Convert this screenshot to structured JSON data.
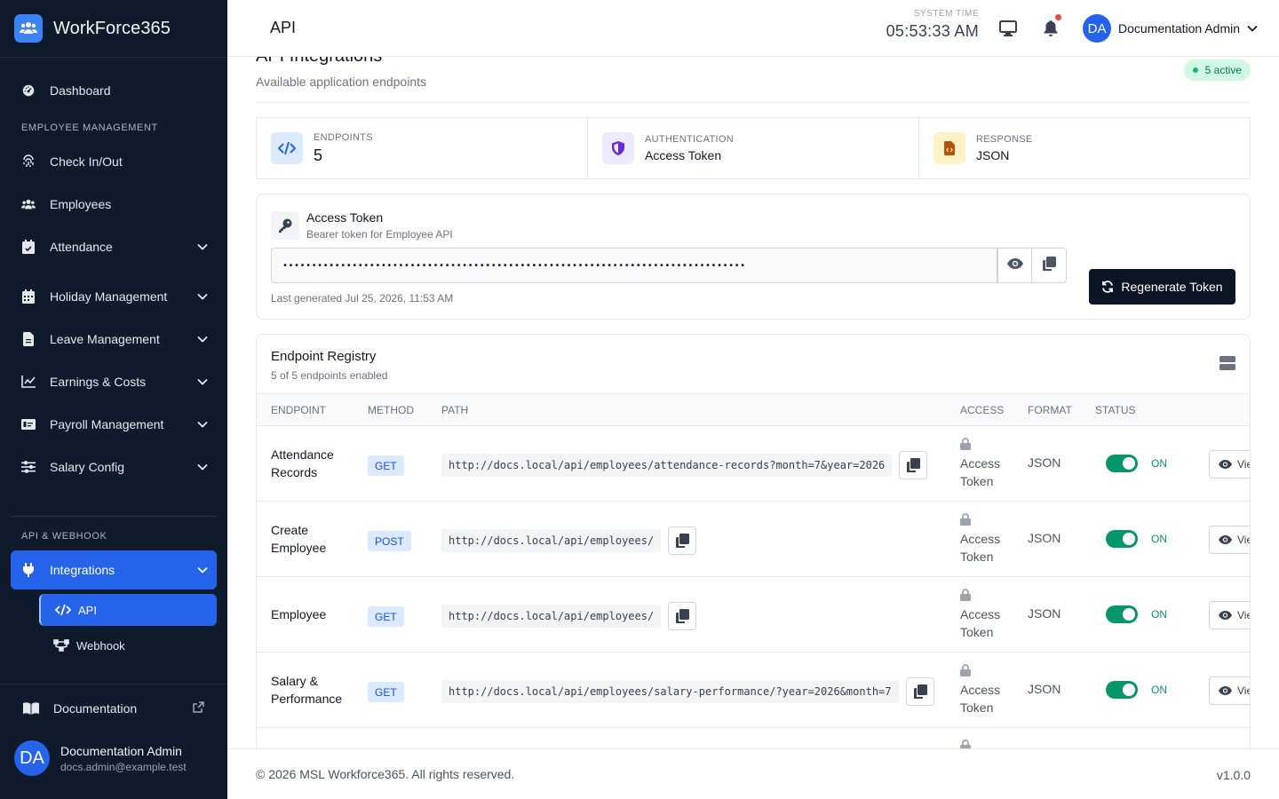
{
  "app": {
    "name": "WorkForce365",
    "brand_color": "#3b82f6"
  },
  "sidebar": {
    "dashboard": "Dashboard",
    "section_employee": "EMPLOYEE MANAGEMENT",
    "items": [
      {
        "label": "Check In/Out",
        "icon": "fingerprint-icon"
      },
      {
        "label": "Employees",
        "icon": "users-icon"
      },
      {
        "label": "Attendance",
        "icon": "calendar-check-icon"
      },
      {
        "label": "Holiday Management",
        "icon": "calendar-icon"
      },
      {
        "label": "Leave Management",
        "icon": "file-icon"
      },
      {
        "label": "Earnings & Costs",
        "icon": "chart-line-icon"
      },
      {
        "label": "Payroll Management",
        "icon": "money-check-icon"
      },
      {
        "label": "Salary Config",
        "icon": "sliders-icon"
      }
    ],
    "section_api": "API & WEBHOOK",
    "integrations": "Integrations",
    "sub_api": "API",
    "sub_webhook": "Webhook",
    "documentation": "Documentation",
    "user": {
      "initials": "DA",
      "name": "Documentation Admin",
      "email": "docs.admin@example.test"
    }
  },
  "header": {
    "title": "API",
    "system_time_label": "SYSTEM TIME",
    "system_time": "05:53:33 AM",
    "user_initials": "DA",
    "user_name": "Documentation Admin"
  },
  "main": {
    "title": "API Integrations",
    "subtitle": "Available application endpoints",
    "active_badge": "5 active",
    "stats": [
      {
        "label": "ENDPOINTS",
        "value": "5",
        "icon": "code-icon"
      },
      {
        "label": "AUTHENTICATION",
        "value": "Access Token",
        "icon": "shield-icon"
      },
      {
        "label": "RESPONSE",
        "value": "JSON",
        "icon": "file-code-icon"
      }
    ],
    "token": {
      "title": "Access Token",
      "subtitle": "Bearer token for Employee API",
      "masked": "••••••••••••••••••••••••••••••••••••••••••••••••••••••••••••••••••••••••••••••••",
      "generated": "Last generated Jul 25, 2026, 11:53 AM",
      "regenerate_label": "Regenerate Token"
    },
    "registry": {
      "title": "Endpoint Registry",
      "subtitle": "5 of 5 endpoints enabled",
      "columns": [
        "ENDPOINT",
        "METHOD",
        "PATH",
        "ACCESS",
        "FORMAT",
        "STATUS"
      ],
      "rows": [
        {
          "name": "Attendance Records",
          "method": "GET",
          "path": "http://docs.local/api/employees/attendance-records?month=7&year=2026",
          "access": "Access Token",
          "format": "JSON",
          "status": "ON",
          "view": "View"
        },
        {
          "name": "Create Employee",
          "method": "POST",
          "path": "http://docs.local/api/employees/",
          "access": "Access Token",
          "format": "JSON",
          "status": "ON",
          "view": "View"
        },
        {
          "name": "Employee",
          "method": "GET",
          "path": "http://docs.local/api/employees/",
          "access": "Access Token",
          "format": "JSON",
          "status": "ON",
          "view": "View"
        },
        {
          "name": "Salary & Performance",
          "method": "GET",
          "path": "http://docs.local/api/employees/salary-performance/?year=2026&month=7",
          "access": "Access Token",
          "format": "JSON",
          "status": "ON",
          "view": "View"
        }
      ]
    }
  },
  "footer": {
    "copyright": "© 2026 MSL Workforce365. All rights reserved.",
    "version": "v1.0.0"
  }
}
